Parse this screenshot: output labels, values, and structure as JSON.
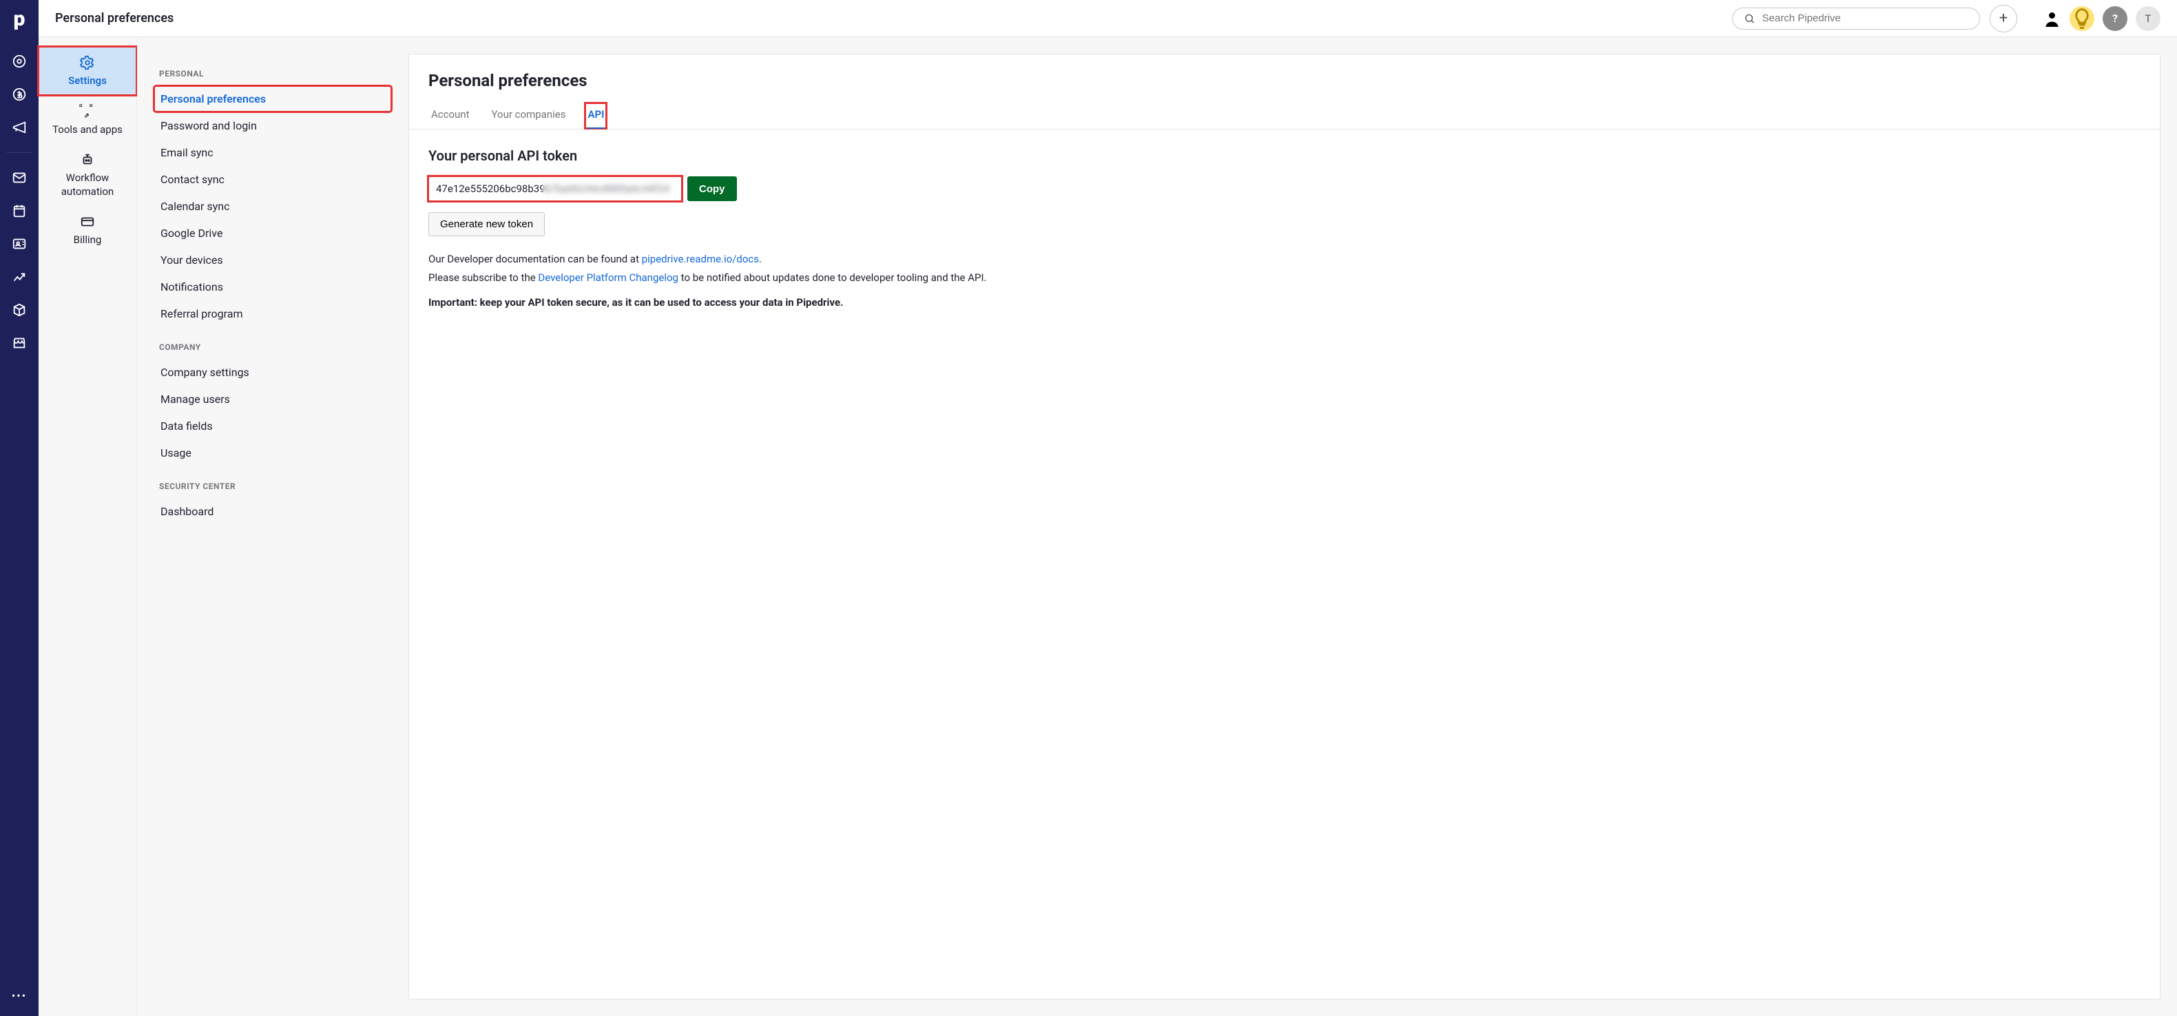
{
  "header": {
    "page_title": "Personal preferences",
    "search_placeholder": "Search Pipedrive",
    "avatar_initial": "T"
  },
  "subnav": {
    "items": [
      {
        "label": "Settings",
        "active": true
      },
      {
        "label": "Tools and apps"
      },
      {
        "label_line1": "Workflow",
        "label_line2": "automation"
      },
      {
        "label": "Billing"
      }
    ]
  },
  "side_menu": {
    "section_personal": "PERSONAL",
    "personal_items": [
      "Personal preferences",
      "Password and login",
      "Email sync",
      "Contact sync",
      "Calendar sync",
      "Google Drive",
      "Your devices",
      "Notifications",
      "Referral program"
    ],
    "section_company": "COMPANY",
    "company_items": [
      "Company settings",
      "Manage users",
      "Data fields",
      "Usage"
    ],
    "section_security": "SECURITY CENTER",
    "security_items": [
      "Dashboard"
    ]
  },
  "panel": {
    "title": "Personal preferences",
    "tabs": [
      {
        "label": "Account"
      },
      {
        "label": "Your companies"
      },
      {
        "label": "API",
        "active": true
      }
    ],
    "section_title": "Your personal API token",
    "token_value": "47e12e555206bc98b39b7ba06244c8885a6c44f24",
    "copy_label": "Copy",
    "generate_label": "Generate new token",
    "doc_text_prefix": "Our Developer documentation can be found at ",
    "doc_link_label": "pipedrive.readme.io/docs",
    "doc_text_suffix": ".",
    "sub_text_prefix": "Please subscribe to the ",
    "sub_link_label": "Developer Platform Changelog",
    "sub_text_suffix": " to be notified about updates done to developer tooling and the API.",
    "important_text": "Important: keep your API token secure, as it can be used to access your data in Pipedrive."
  }
}
